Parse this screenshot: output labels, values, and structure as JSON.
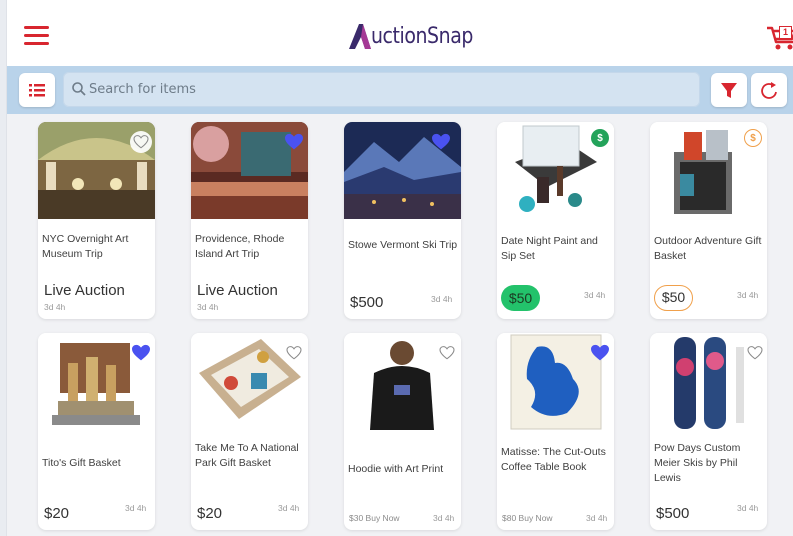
{
  "app": {
    "logo_text": "uctionSnap",
    "cart_count": "1"
  },
  "search": {
    "placeholder": "Search for items"
  },
  "colors": {
    "brand_red": "#d8262f",
    "search_bar": "#b9d3ea",
    "heart_fill": "#4a52f0",
    "green_pill": "#23c26b",
    "orange_accent": "#f0a04b"
  },
  "items": [
    {
      "title": "NYC Overnight Art Museum Trip",
      "status": "Live Auction",
      "time": "3d 4h",
      "favorited": false
    },
    {
      "title": "Providence, Rhode Island Art Trip",
      "status": "Live Auction",
      "time": "3d 4h",
      "favorited": true
    },
    {
      "title": "Stowe Vermont Ski Trip",
      "price": "$500",
      "time": "3d 4h",
      "favorited": true
    },
    {
      "title": "Date Night Paint and Sip Set",
      "price": "$50",
      "time": "3d 4h",
      "price_style": "green-pill",
      "badge": "$",
      "favorited": false
    },
    {
      "title": "Outdoor Adventure Gift Basket",
      "price": "$50",
      "time": "3d 4h",
      "price_style": "orange-outline",
      "badge": "$",
      "favorited": false
    },
    {
      "title": "Tito's Gift Basket",
      "price": "$20",
      "time": "3d 4h",
      "favorited": true
    },
    {
      "title": "Take Me To A National Park Gift Basket",
      "price": "$20",
      "time": "3d 4h",
      "favorited": false
    },
    {
      "title": "Hoodie with Art Print",
      "buy_now": "$30 Buy Now",
      "time": "3d 4h",
      "favorited": false
    },
    {
      "title": "Matisse: The Cut-Outs Coffee Table Book",
      "buy_now": "$80 Buy Now",
      "time": "3d 4h",
      "favorited": true
    },
    {
      "title": "Pow Days Custom Meier Skis by Phil Lewis",
      "price": "$500",
      "time": "3d 4h",
      "favorited": false
    }
  ]
}
